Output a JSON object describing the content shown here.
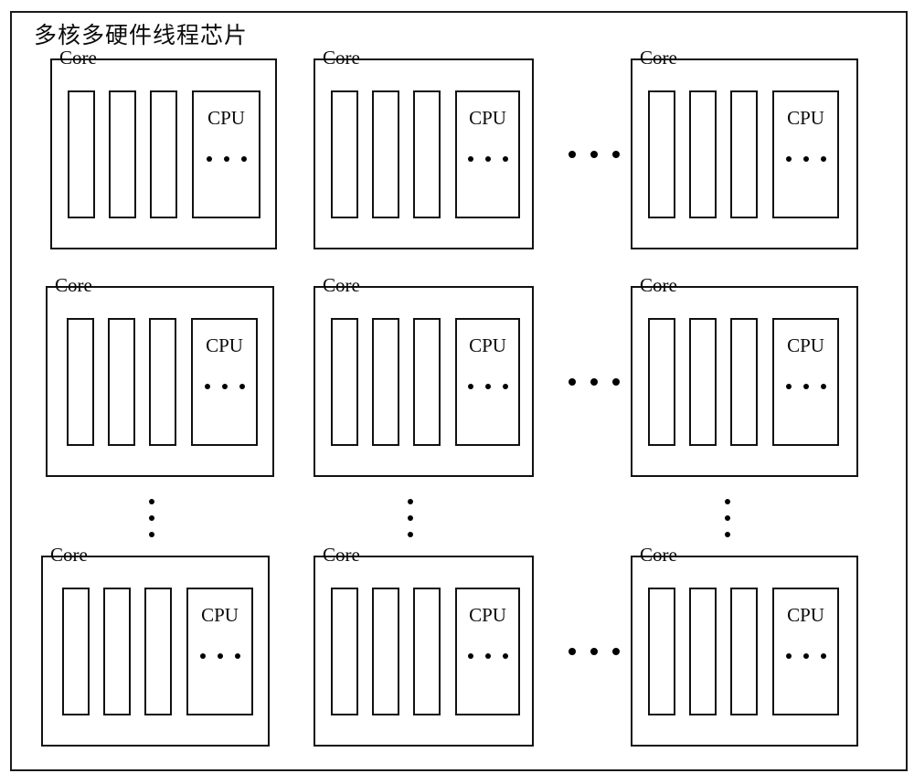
{
  "diagram": {
    "title": "多核多硬件线程芯片",
    "outer_box_label": "多核多硬件线程芯片",
    "core_label": "Core",
    "cpu_label": "CPU",
    "threads_per_core": 3,
    "cpu_blocks_per_core": 1,
    "core_rows": 3,
    "core_columns": 3,
    "ellipsis_dot": "•",
    "colors": {
      "stroke": "#111111",
      "background": "#ffffff",
      "text": "#0a0a0a"
    },
    "cores": [
      {
        "id": "core-r1-c1",
        "label": "Core",
        "cpu_label": "CPU",
        "row": 1,
        "col": 1
      },
      {
        "id": "core-r1-c2",
        "label": "Core",
        "cpu_label": "CPU",
        "row": 1,
        "col": 2
      },
      {
        "id": "core-r1-c3",
        "label": "Core",
        "cpu_label": "CPU",
        "row": 1,
        "col": 3
      },
      {
        "id": "core-r2-c1",
        "label": "Core",
        "cpu_label": "CPU",
        "row": 2,
        "col": 1
      },
      {
        "id": "core-r2-c2",
        "label": "Core",
        "cpu_label": "CPU",
        "row": 2,
        "col": 2
      },
      {
        "id": "core-r2-c3",
        "label": "Core",
        "cpu_label": "CPU",
        "row": 2,
        "col": 3
      },
      {
        "id": "core-r3-c1",
        "label": "Core",
        "cpu_label": "CPU",
        "row": 3,
        "col": 1
      },
      {
        "id": "core-r3-c2",
        "label": "Core",
        "cpu_label": "CPU",
        "row": 3,
        "col": 2
      },
      {
        "id": "core-r3-c3",
        "label": "Core",
        "cpu_label": "CPU",
        "row": 3,
        "col": 3
      }
    ],
    "row_ellipsis_label": "…",
    "column_ellipsis_label": "⋮"
  }
}
